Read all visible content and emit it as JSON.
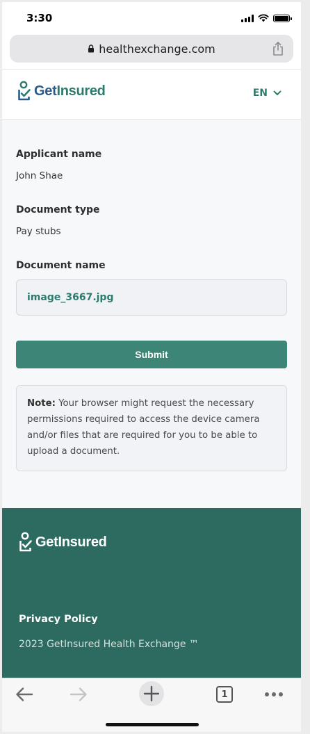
{
  "status_bar": {
    "time": "3:30",
    "icons": [
      "signal-icon",
      "wifi-icon",
      "battery-icon"
    ]
  },
  "browser": {
    "url": "healthexchange.com",
    "icons": [
      "lock-icon",
      "share-icon"
    ]
  },
  "header": {
    "logo_part1": "Get",
    "logo_part2": "Insured",
    "language": "EN"
  },
  "form": {
    "applicant_label": "Applicant name",
    "applicant_value": "John Shae",
    "doc_type_label": "Document type",
    "doc_type_value": "Pay stubs",
    "doc_name_label": "Document name",
    "doc_name_value": "image_3667.jpg",
    "submit_label": "Submit",
    "note_prefix": "Note:",
    "note_text": " Your browser might request the necessary permissions required to access the device camera and/or files that are required for you to be able to upload a document."
  },
  "footer": {
    "logo_text": "GetInsured",
    "privacy_label": "Privacy Policy",
    "copyright": "2023 GetInsured Health Exchange ™"
  },
  "toolbar": {
    "tab_count": "1",
    "icons": [
      "back-arrow-icon",
      "forward-arrow-icon",
      "new-tab-plus-icon",
      "tabs-icon",
      "more-dots-icon"
    ]
  },
  "colors": {
    "brand_green": "#3c8577",
    "footer_bg": "#2d6b61",
    "brand_blue": "#2a5b8c"
  }
}
